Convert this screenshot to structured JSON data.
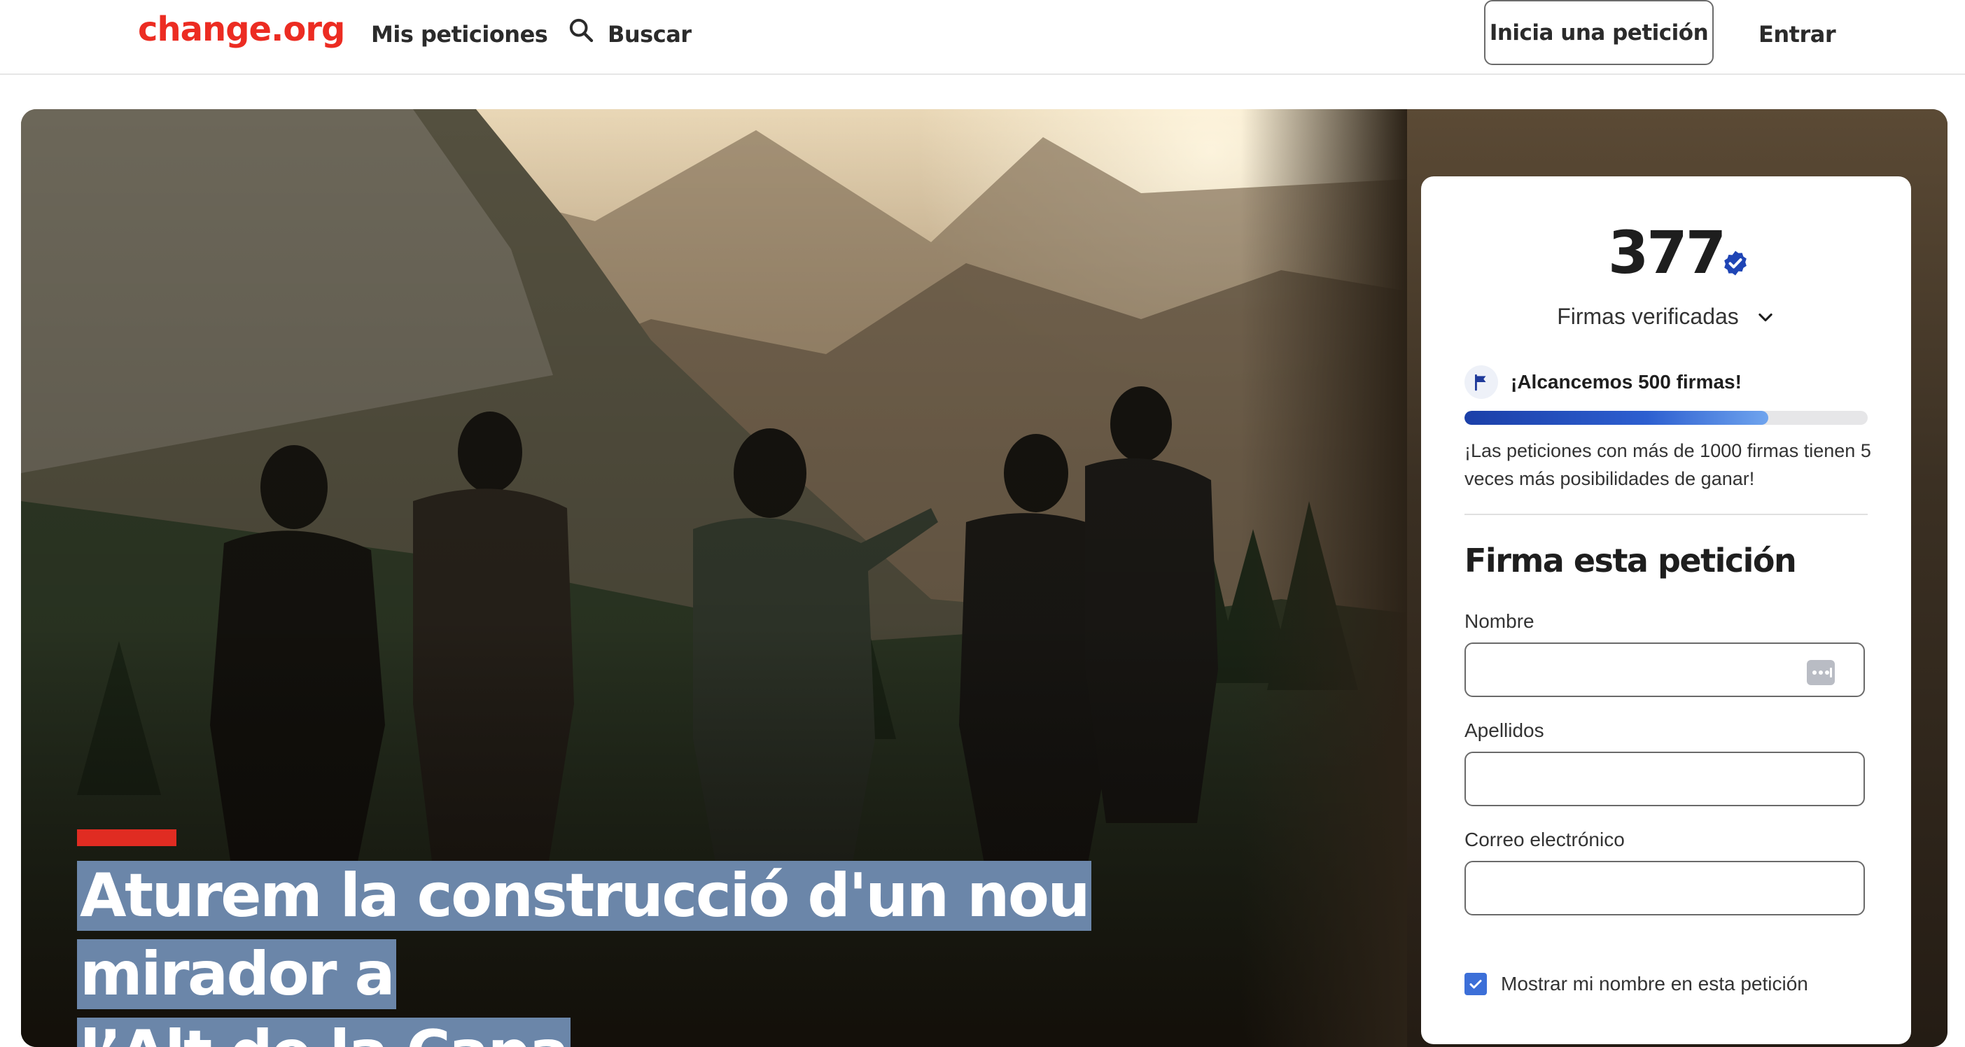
{
  "header": {
    "logo": "change.org",
    "my_petitions": "Mis peticiones",
    "search": "Buscar",
    "start_petition": "Inicia una petición",
    "login": "Entrar"
  },
  "hero": {
    "title_line1": "Aturem la construcció d'un nou mirador a",
    "title_line2": "l’Alt de la Capa"
  },
  "signature_card": {
    "count": "377",
    "verified_label": "Firmas verificadas",
    "goal_label": "¡Alcancemos 500 firmas!",
    "progress_fraction": 0.754,
    "goal_note": "¡Las peticiones con más de 1000 firmas tienen 5 veces más posibilidades de ganar!",
    "form_title": "Firma esta petición",
    "fields": {
      "first_name_label": "Nombre",
      "first_name_value": "",
      "last_name_label": "Apellidos",
      "last_name_value": "",
      "email_label": "Correo electrónico",
      "email_value": ""
    },
    "show_name_label": "Mostrar mi nombre en esta petición",
    "show_name_checked": true
  },
  "icons": [
    "search-icon",
    "verified-badge-icon",
    "chevron-down-icon",
    "flag-icon",
    "autofill-key-icon",
    "checkmark-icon"
  ],
  "colors": {
    "brand": "#ec2c22",
    "accent_bar": "#e02c22",
    "progress": "#1b3fa8",
    "verified": "#1f45b5",
    "title_highlight": "#6b86a9"
  }
}
